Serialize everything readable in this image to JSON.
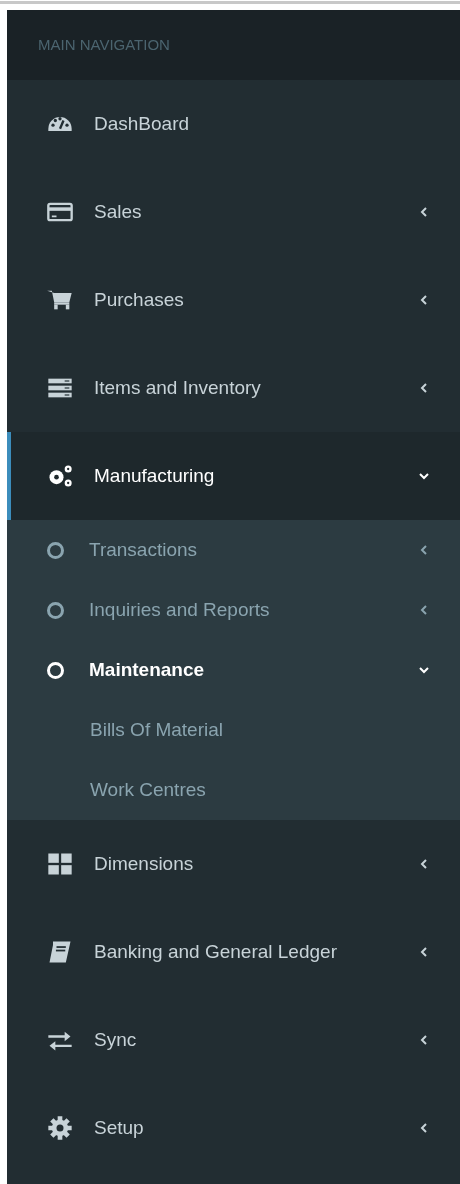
{
  "sidebar": {
    "header": "MAIN NAVIGATION",
    "items": [
      {
        "label": "DashBoard",
        "selected": false
      },
      {
        "label": "Sales",
        "selected": false,
        "expanded": false
      },
      {
        "label": "Purchases",
        "selected": false,
        "expanded": false
      },
      {
        "label": "Items and Inventory",
        "selected": false,
        "expanded": false
      },
      {
        "label": "Manufacturing",
        "selected": true,
        "expanded": true,
        "children": [
          {
            "label": "Transactions",
            "selected": false,
            "expanded": false
          },
          {
            "label": "Inquiries and Reports",
            "selected": false,
            "expanded": false
          },
          {
            "label": "Maintenance",
            "selected": true,
            "expanded": true,
            "children": [
              {
                "label": "Bills Of Material",
                "selected": false
              },
              {
                "label": "Work Centres",
                "selected": false
              }
            ]
          }
        ]
      },
      {
        "label": "Dimensions",
        "selected": false,
        "expanded": false
      },
      {
        "label": "Banking and General Ledger",
        "selected": false,
        "expanded": false
      },
      {
        "label": "Sync",
        "selected": false,
        "expanded": false
      },
      {
        "label": "Setup",
        "selected": false,
        "expanded": false
      }
    ]
  }
}
